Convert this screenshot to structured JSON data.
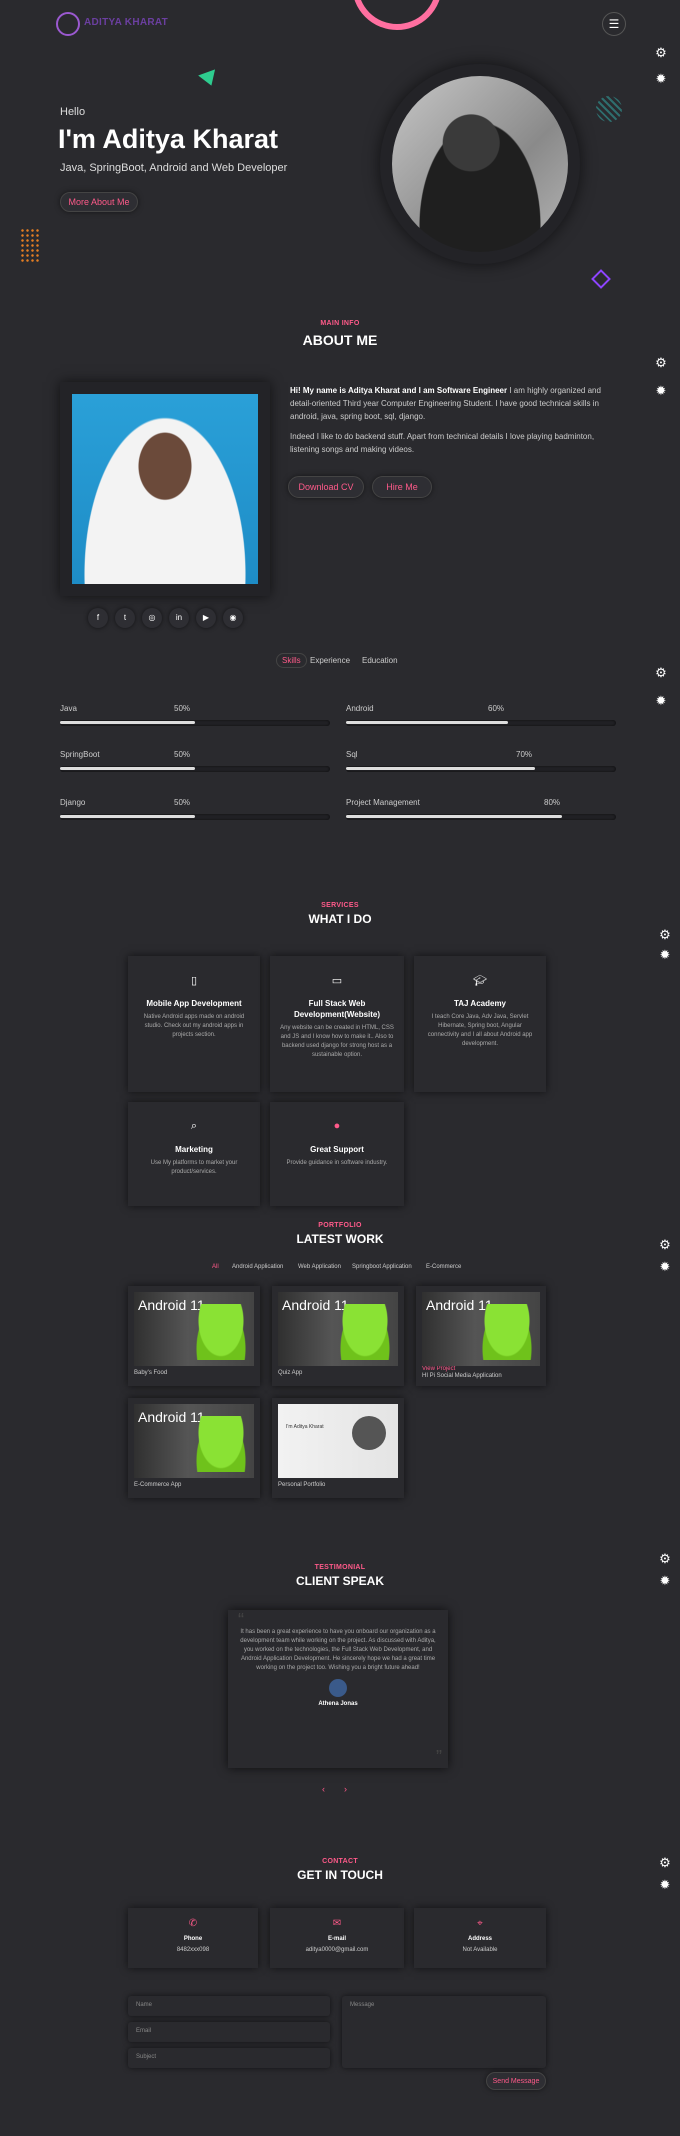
{
  "header": {
    "logo_text": "ADITYA KHARAT",
    "menu_icon": "hamburger-icon"
  },
  "hero": {
    "greeting": "Hello",
    "name": "I'm Aditya Kharat",
    "subtitle": "Java, SpringBoot, Android and Web Developer",
    "button": "More About Me"
  },
  "about": {
    "tag": "MAIN INFO",
    "title": "ABOUT ME",
    "intro_bold": "Hi! My name is Aditya Kharat and I am Software Engineer",
    "intro_rest": " I am highly organized and detail-oriented Third year Computer Engineering Student. I have good technical skills in android, java, spring boot, sql, django.",
    "para2": "Indeed I like to do backend stuff. Apart from technical details I love playing badminton, listening songs and making videos.",
    "btn_cv": "Download CV",
    "btn_hire": "Hire Me",
    "socials": [
      "facebook-icon",
      "twitter-icon",
      "instagram-icon",
      "linkedin-icon",
      "youtube-icon",
      "github-icon"
    ]
  },
  "tabs": [
    "Skills",
    "Experience",
    "Education"
  ],
  "skills": [
    {
      "name": "Java",
      "pct": "50%",
      "value": 50
    },
    {
      "name": "Android",
      "pct": "60%",
      "value": 60
    },
    {
      "name": "SpringBoot",
      "pct": "50%",
      "value": 50
    },
    {
      "name": "Sql",
      "pct": "70%",
      "value": 70
    },
    {
      "name": "Django",
      "pct": "50%",
      "value": 50
    },
    {
      "name": "Project Management",
      "pct": "80%",
      "value": 80
    }
  ],
  "services": {
    "tag": "SERVICES",
    "title": "WHAT I DO",
    "items": [
      {
        "icon": "mobile-icon",
        "title": "Mobile App Development",
        "desc": "Native Android apps made on android studio. Check out my android apps in projects section."
      },
      {
        "icon": "laptop-icon",
        "title": "Full Stack Web Development(Website)",
        "desc": "Any website can be created in HTML, CSS and JS and I know how to make it.. Also to backend used django for strong host as a sustainable option."
      },
      {
        "icon": "graduation-icon",
        "title": "TAJ Academy",
        "desc": "I teach Core Java, Adv Java, Servlet Hibernate, Spring boot, Angular connectivity and I all about Android app development."
      },
      {
        "icon": "search-icon",
        "title": "Marketing",
        "desc": "Use My platforms to market your product/services."
      },
      {
        "icon": "mic-icon",
        "title": "Great Support",
        "desc": "Provide guidance in software industry."
      }
    ]
  },
  "portfolio": {
    "tag": "PORTFOLIO",
    "title": "LATEST WORK",
    "filters": [
      "All",
      "Android Application",
      "Web Application",
      "Springboot Application",
      "E-Commerce"
    ],
    "works": [
      {
        "caption": "Baby's Food",
        "img_text": "Android 11"
      },
      {
        "caption": "Quiz App",
        "img_text": "Android 11"
      },
      {
        "caption": "HI Pi Social Media Application",
        "img_text": "Android 11",
        "link": "View Project"
      },
      {
        "caption": "E-Commerce App",
        "img_text": "Android 11"
      },
      {
        "caption": "Personal Portfolio",
        "img_text": "I'm Aditya Kharat"
      }
    ]
  },
  "testimonial": {
    "tag": "TESTIMONIAL",
    "title": "CLIENT SPEAK",
    "quote": "It has been a great experience to have you onboard our organization as a development team while working on the project. As discussed with Aditya, you worked on the technologies, the Full Stack Web Development, and Android Application Development. He sincerely hope we had a great time working on the project too. Wishing you a bright future ahead!",
    "author": "Athena Jonas"
  },
  "contact": {
    "tag": "CONTACT",
    "title": "GET IN TOUCH",
    "cards": [
      {
        "icon": "phone-icon",
        "label": "Phone",
        "value": "8482xxx098"
      },
      {
        "icon": "envelope-icon",
        "label": "E-mail",
        "value": "aditya0000@gmail.com"
      },
      {
        "icon": "map-pin-icon",
        "label": "Address",
        "value": "Not Available"
      }
    ],
    "name_ph": "Name",
    "email_ph": "Email",
    "subject_ph": "Subject",
    "message_ph": "Message",
    "send": "Send Message"
  }
}
